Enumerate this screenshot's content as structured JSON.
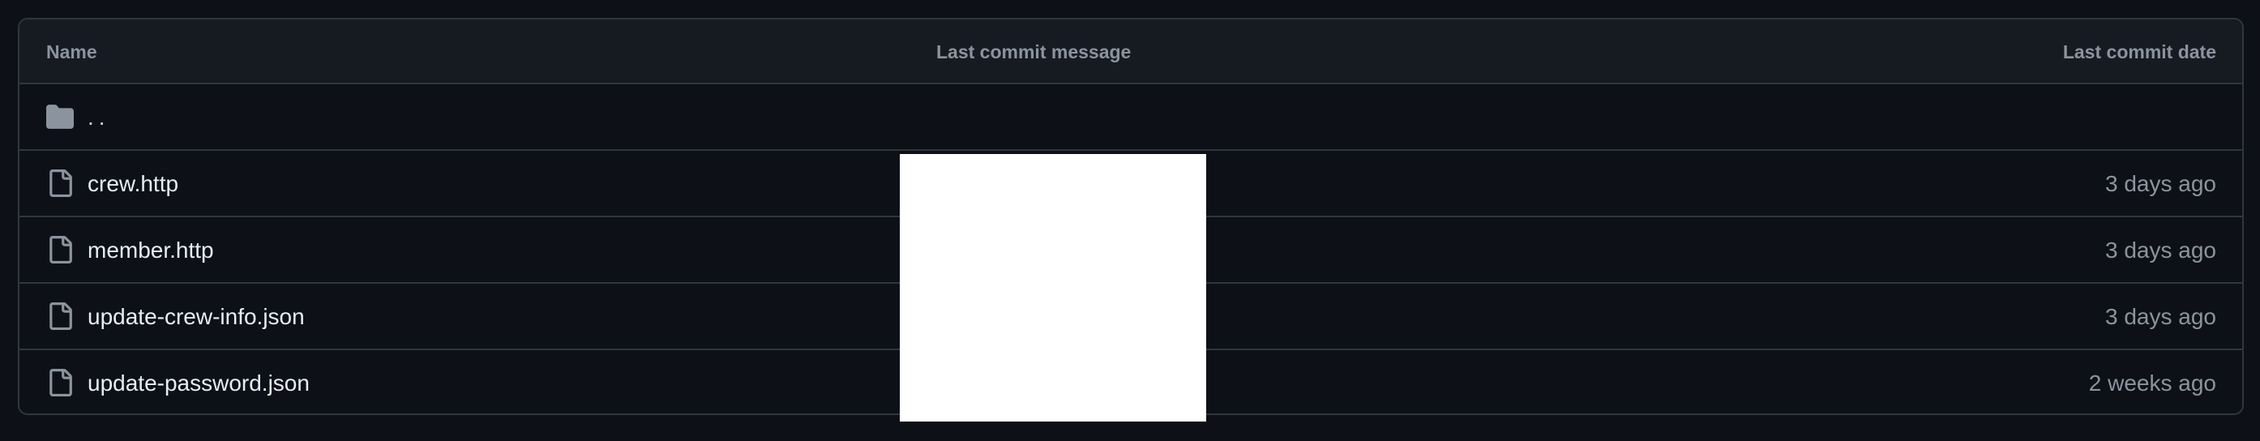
{
  "table": {
    "headers": {
      "name": "Name",
      "last_commit_message": "Last commit message",
      "last_commit_date": "Last commit date"
    },
    "parent_dir": {
      "label": "..",
      "icon": "folder-icon"
    },
    "files": [
      {
        "name": "crew.http",
        "date": "3 days ago",
        "icon": "file-icon"
      },
      {
        "name": "member.http",
        "date": "3 days ago",
        "icon": "file-icon"
      },
      {
        "name": "update-crew-info.json",
        "date": "3 days ago",
        "icon": "file-icon"
      },
      {
        "name": "update-password.json",
        "date": "2 weeks ago",
        "icon": "file-icon"
      }
    ]
  },
  "colors": {
    "background": "#0d1117",
    "header_background": "#161b22",
    "border": "#30363d",
    "text_primary": "#e6edf3",
    "text_muted": "#8b949e",
    "redaction": "#ffffff"
  }
}
